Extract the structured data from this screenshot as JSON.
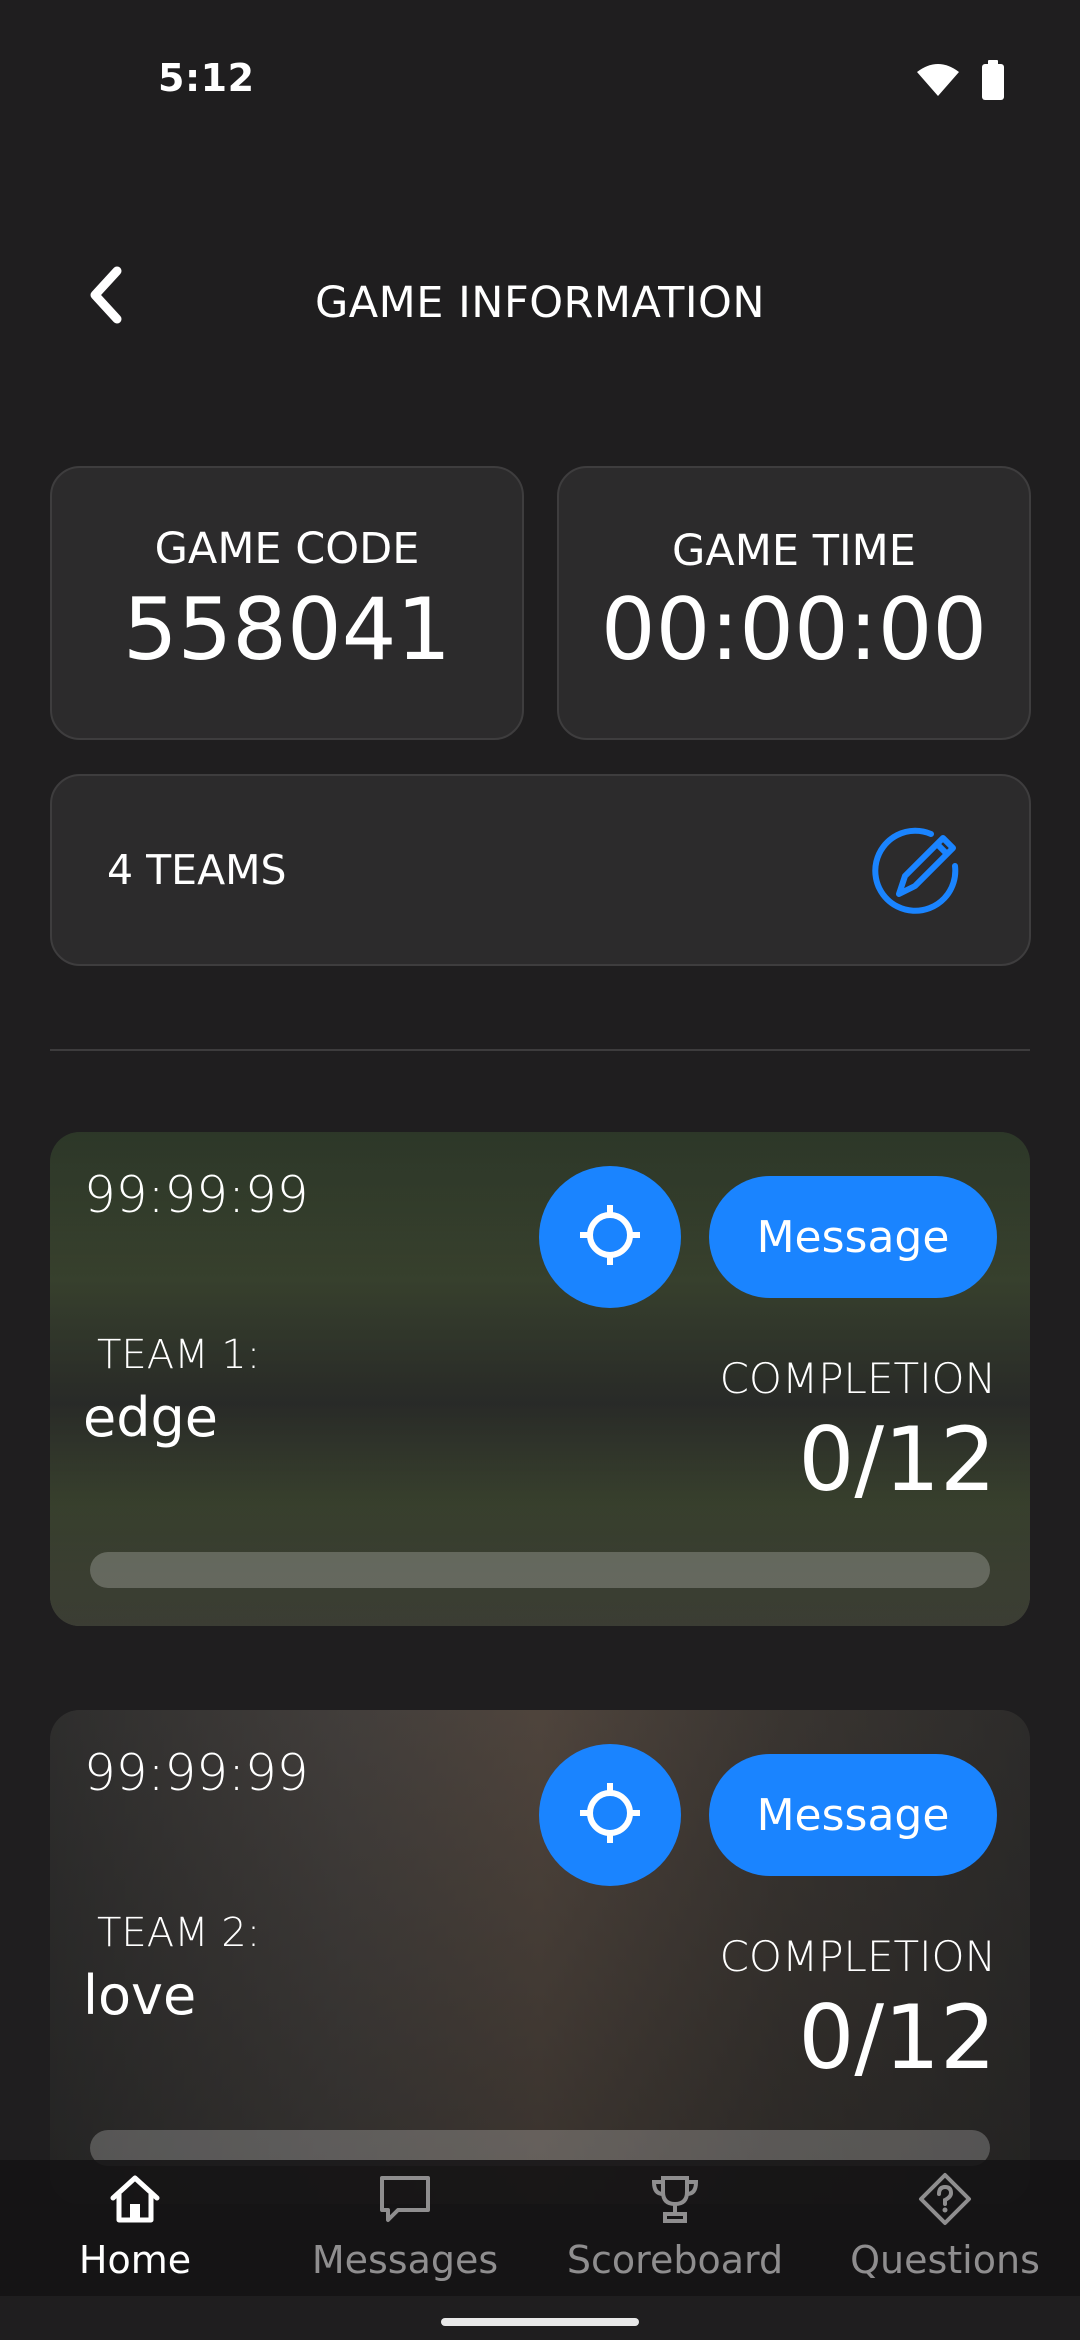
{
  "status_bar": {
    "time": "5:12"
  },
  "header": {
    "title": "GAME INFORMATION"
  },
  "game_code": {
    "label": "GAME CODE",
    "value": "558041"
  },
  "game_time": {
    "label": "GAME TIME",
    "value": "00:00:00"
  },
  "teams_summary": {
    "label": "4 TEAMS"
  },
  "teams": [
    {
      "timer": "99:99:99",
      "label": "TEAM 1:",
      "name": "edge",
      "completion_label": "COMPLETION",
      "completion": "0/12",
      "progress": 0,
      "message_label": "Message"
    },
    {
      "timer": "99:99:99",
      "label": "TEAM 2:",
      "name": "love",
      "completion_label": "COMPLETION",
      "completion": "0/12",
      "progress": 0,
      "message_label": "Message"
    }
  ],
  "nav": [
    {
      "label": "Home",
      "icon": "home-icon",
      "active": true
    },
    {
      "label": "Messages",
      "icon": "chat-bubble-icon",
      "active": false
    },
    {
      "label": "Scoreboard",
      "icon": "trophy-icon",
      "active": false
    },
    {
      "label": "Questions",
      "icon": "question-diamond-icon",
      "active": false
    }
  ],
  "colors": {
    "accent": "#1a84ff",
    "background": "#1f1e1f",
    "card": "#2c2b2c"
  }
}
